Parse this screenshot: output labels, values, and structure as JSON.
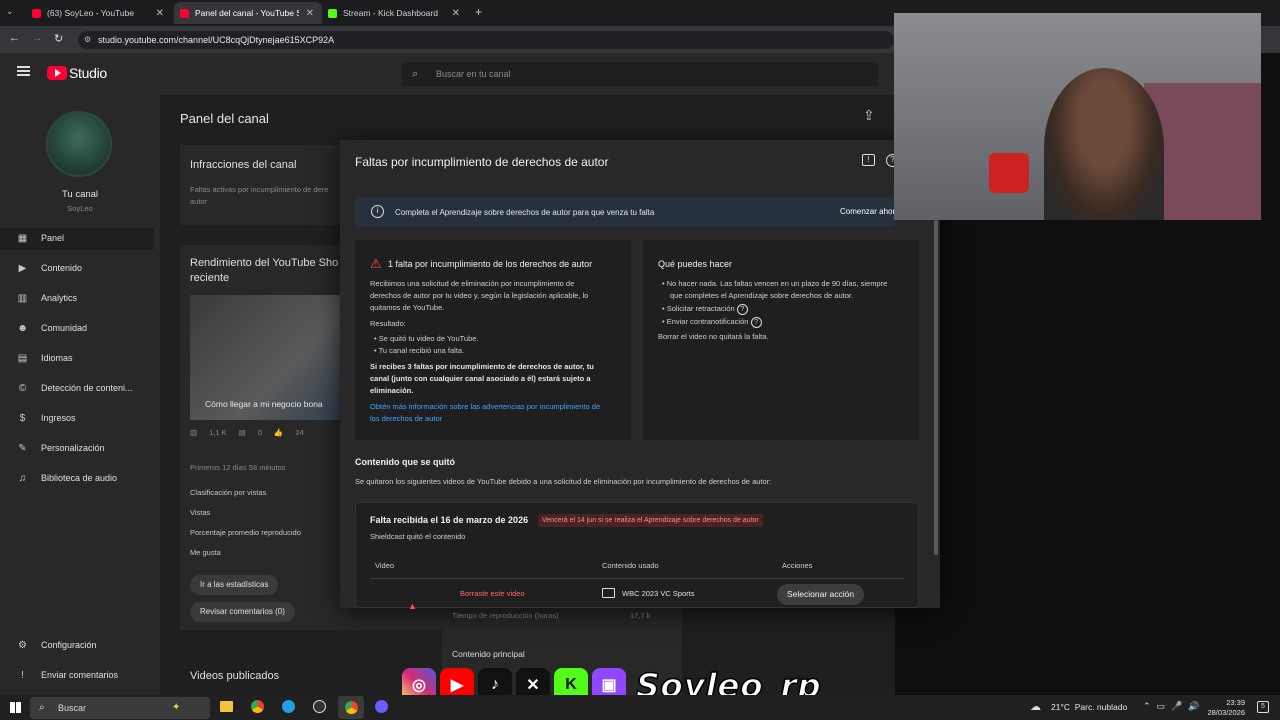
{
  "browser": {
    "tabs": [
      {
        "label": "(63) SoyLeo - YouTube",
        "color": "#ff0033"
      },
      {
        "label": "Panel del canal - YouTube Studi",
        "color": "#ff0033"
      },
      {
        "label": "Stream - Kick Dashboard",
        "color": "#53fc18"
      }
    ],
    "url": "studio.youtube.com/channel/UC8cqQjDtynejae615XCP92A"
  },
  "studio": {
    "logo": "Studio",
    "search_placeholder": "Buscar en tu canal",
    "page_title": "Panel del canal",
    "channel_label": "Tu canal",
    "channel_name": "SoyLeo",
    "nav": [
      {
        "label": "Panel",
        "icon": "dashboard-icon"
      },
      {
        "label": "Contenido",
        "icon": "content-icon"
      },
      {
        "label": "Analytics",
        "icon": "analytics-icon"
      },
      {
        "label": "Comunidad",
        "icon": "community-icon"
      },
      {
        "label": "Idiomas",
        "icon": "subtitles-icon"
      },
      {
        "label": "Detección de conteni...",
        "icon": "copyright-icon"
      },
      {
        "label": "Ingresos",
        "icon": "dollar-icon"
      },
      {
        "label": "Personalización",
        "icon": "wand-icon"
      },
      {
        "label": "Biblioteca de audio",
        "icon": "audio-library-icon"
      }
    ],
    "nav_bottom": [
      {
        "label": "Configuración",
        "icon": "gear-icon"
      },
      {
        "label": "Enviar comentarios",
        "icon": "feedback-icon"
      }
    ],
    "infractions_card": {
      "title": "Infracciones del canal",
      "body_l1": "Faltas activas por incumplimiento de dere",
      "body_l2": "autor"
    },
    "shorts_card": {
      "title_l1": "Rendimiento del YouTube Sho",
      "title_l2": "reciente",
      "thumb_title": "Cómo llegar a mi negocio bona",
      "views": "1,1 K",
      "comments": "0",
      "likes": "24",
      "period": "Primeros 12 días 58 minutos",
      "stats": [
        "Clasificación por vistas",
        "Vistas",
        "Porcentaje promedio reproducido",
        "Me gusta"
      ],
      "btn_stats": "Ir a las estadísticas",
      "btn_comments": "Revisar comentarios (0)"
    },
    "published_title": "Videos publicados",
    "behind_rows": {
      "watch_time_label": "Tiempo de reproducción (horas)",
      "watch_time_value": "17,7 k",
      "main_content": "Contenido principal"
    }
  },
  "dialog": {
    "title": "Faltas por incumplimiento de derechos de autor",
    "banner_text": "Completa el Aprendizaje sobre derechos de autor para que venza tu falta",
    "banner_button": "Comenzar ahora",
    "strike_title": "1 falta por incumplimiento de los derechos de autor",
    "strike_body": [
      "Recibimos una solicitud de eliminación por incumplimiento de",
      "derechos de autor por tu video y, según la legislación aplicable, lo",
      "quitamos de YouTube."
    ],
    "result_label": "Resultado:",
    "result_items": [
      "Se quitó tu video de YouTube.",
      "Tu canal recibió una falta."
    ],
    "warning_text": [
      "Si recibes 3 faltas por incumplimiento de derechos de autor, tu",
      "canal (junto con cualquier canal asociado a él) estará sujeto a",
      "eliminación."
    ],
    "learn_more": [
      "Obtén más información sobre las advertencias por incumplimiento de",
      "los derechos de autor"
    ],
    "what_title": "Qué puedes hacer",
    "what_items": [
      "No hacer nada. Las faltas vencen en un plazo de 90 días, siempre",
      "que completes el Aprendizaje sobre derechos de autor.",
      "Solicitar retractación",
      "Enviar contranotificación"
    ],
    "delete_note": "Borrar el video no quitará la falta.",
    "removed_title": "Contenido que se quitó",
    "removed_desc": "Se quitaron los siguientes videos de YouTube debido a una solicitud de eliminación por incumplimiento de derechos de autor:",
    "strike_date": "Falta recibida el 16 de marzo de 2026",
    "expires_tag": "Vencerá el 14 jun si se realiza el Aprendizaje sobre derechos de autor",
    "claimant": "Shieldcast quitó el contenido",
    "table_headers": [
      "Video",
      "Contenido usado",
      "Acciones"
    ],
    "row": {
      "video": "Borraste este video",
      "content": "WBC 2023 VC Sports",
      "action": "Selecionar acción"
    }
  },
  "overlay": {
    "handle": "Soyleo_rp",
    "icons": [
      "instagram",
      "youtube",
      "tiktok",
      "x",
      "kick",
      "twitch"
    ]
  },
  "taskbar": {
    "search": "Buscar",
    "weather": "21°C  Parc. nublado",
    "time": "23:39",
    "date": "28/03/2026"
  }
}
